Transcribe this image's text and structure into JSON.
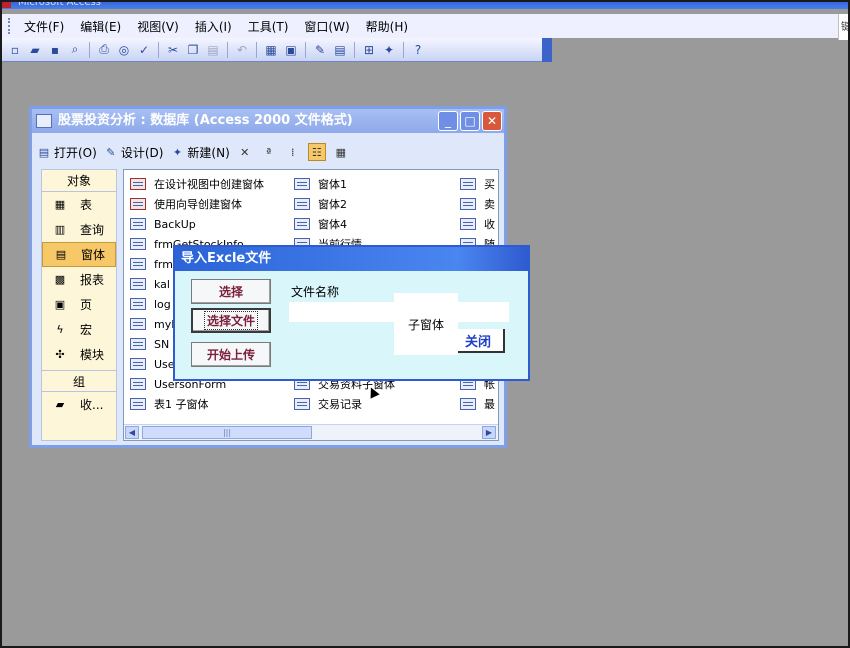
{
  "app": {
    "title": "Microsoft Access"
  },
  "menubar": [
    "文件(F)",
    "编辑(E)",
    "视图(V)",
    "插入(I)",
    "工具(T)",
    "窗口(W)",
    "帮助(H)"
  ],
  "toolbar_icons": [
    "new-icon",
    "open-icon",
    "save-icon",
    "search-icon",
    "print-icon",
    "print-preview-icon",
    "spelling-icon",
    "cut-icon",
    "copy-icon",
    "paste-icon",
    "undo-icon",
    "office-links-icon",
    "analyze-icon",
    "code-icon",
    "properties-icon",
    "relationships-icon",
    "new-object-icon",
    "help-icon"
  ],
  "right_strip_char": "键",
  "db_window": {
    "title": "股票投资分析 : 数据库 (Access 2000 文件格式)",
    "toolbar": {
      "open": "打开(O)",
      "design": "设计(D)",
      "new": "新建(N)"
    },
    "objects_header": "对象",
    "objects": [
      "表",
      "查询",
      "窗体",
      "报表",
      "页",
      "宏",
      "模块"
    ],
    "selected_object": "窗体",
    "groups_header": "组",
    "groups": [
      "收..."
    ],
    "columns": [
      [
        "在设计视图中创建窗体",
        "使用向导创建窗体",
        "BackUp",
        "frmGetStockInfo",
        "frm",
        "kal",
        "log",
        "myI",
        "SN",
        "Use",
        "UsersonForm",
        "表1 子窗体"
      ],
      [
        "窗体1",
        "窗体2",
        "窗体4",
        "当前行情",
        "",
        "",
        "",
        "",
        "",
        "",
        "交易资料子窗体",
        "交易记录"
      ],
      [
        "买",
        "卖",
        "收",
        "随",
        "",
        "",
        "",
        "",
        "",
        "",
        "帐",
        "最"
      ]
    ]
  },
  "dialog": {
    "title": "导入Excle文件",
    "buttons": {
      "select": "选择",
      "select_file": "选择文件",
      "start_upload": "开始上传",
      "close": "关闭"
    },
    "file_name_label": "文件名称",
    "popup_text": "子窗体"
  }
}
